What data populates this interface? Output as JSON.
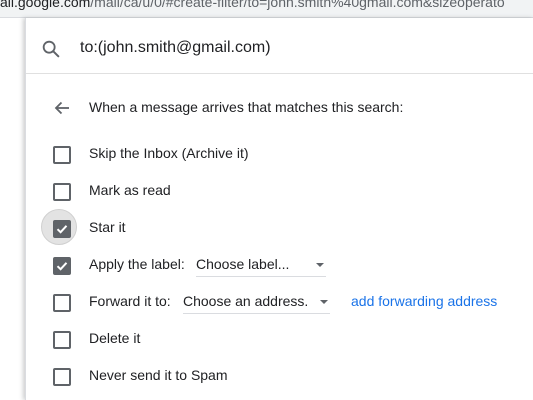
{
  "browser": {
    "url_domain": "ail.google.com",
    "url_path": "/mail/ca/u/0/#create-filter/to=john.smith%40gmail.com&sizeoperato"
  },
  "search": {
    "query": "to:(john.smith@gmail.com)"
  },
  "filter_panel": {
    "header": "When a message arrives that matches this search:",
    "options": {
      "skip_inbox": {
        "label": "Skip the Inbox (Archive it)",
        "checked": false
      },
      "mark_read": {
        "label": "Mark as read",
        "checked": false
      },
      "star": {
        "label": "Star it",
        "checked": true
      },
      "apply_label": {
        "label": "Apply the label:",
        "checked": true,
        "select_value": "Choose label..."
      },
      "forward": {
        "label": "Forward it to:",
        "checked": false,
        "select_value": "Choose an address.",
        "link": "add forwarding address"
      },
      "delete": {
        "label": "Delete it",
        "checked": false
      },
      "never_spam": {
        "label": "Never send it to Spam",
        "checked": false
      }
    }
  },
  "colors": {
    "checkbox": "#5f6368",
    "link": "#1a73e8",
    "text": "#202124"
  },
  "icons": {
    "search": "search-icon",
    "back": "arrow-left-icon",
    "checkmark": "checkmark-icon",
    "dropdown": "caret-down-icon"
  }
}
